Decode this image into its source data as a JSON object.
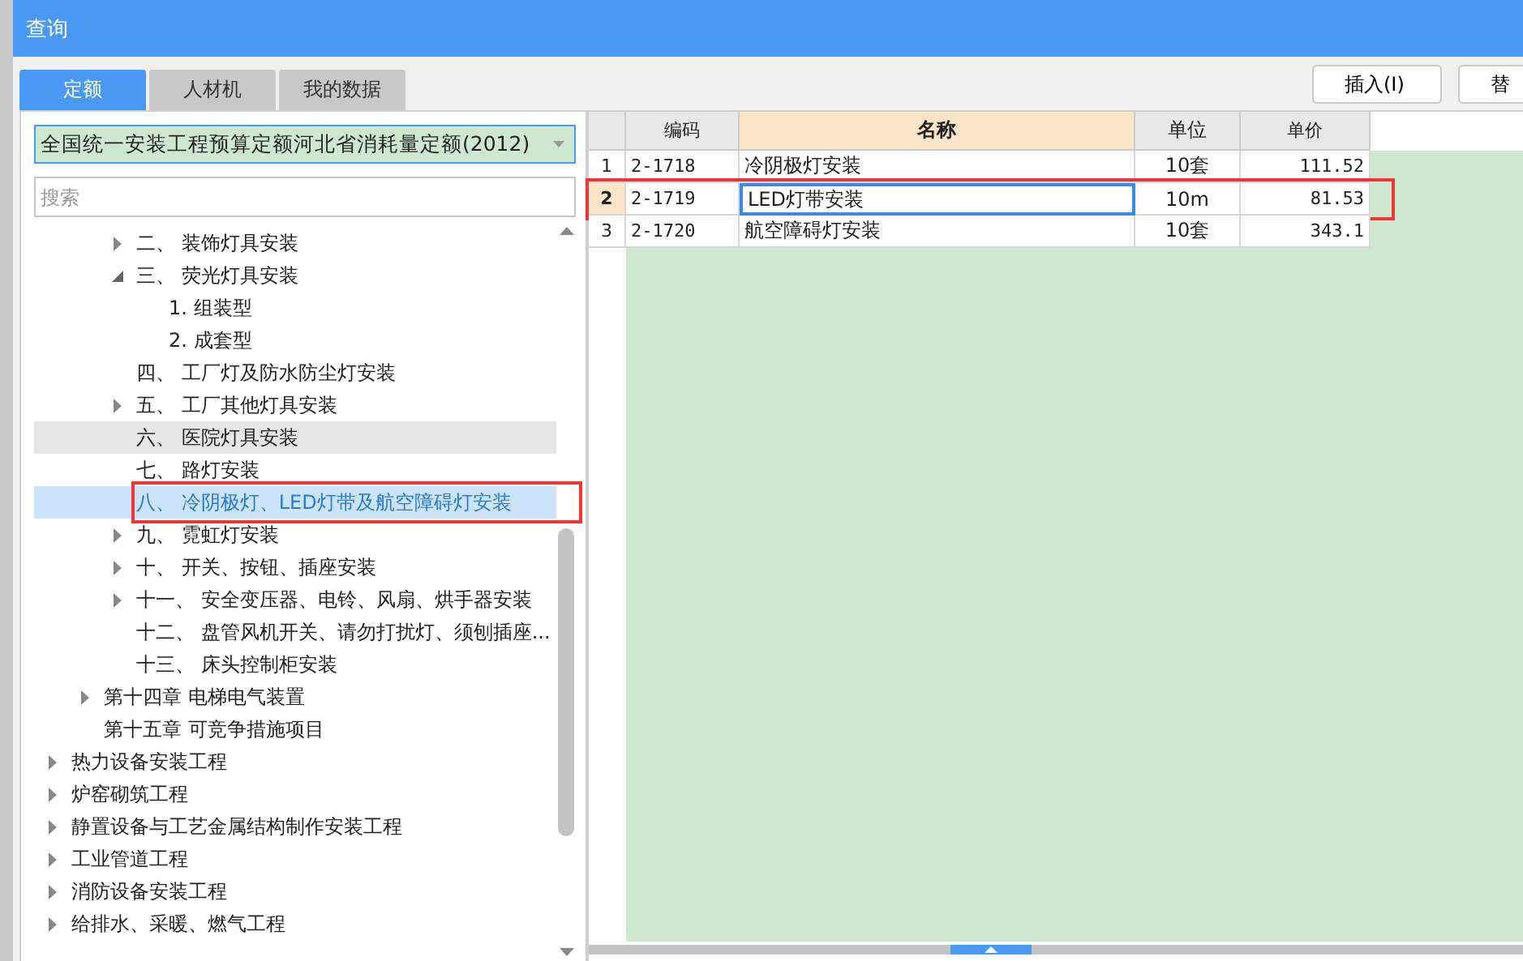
{
  "window": {
    "title": "查询"
  },
  "tabs": [
    {
      "label": "定额",
      "selected": true
    },
    {
      "label": "人材机",
      "selected": false
    },
    {
      "label": "我的数据",
      "selected": false
    }
  ],
  "buttons": [
    "插入(I)",
    "替"
  ],
  "library_select": {
    "value": "全国统一安装工程预算定额河北省消耗量定额(2012)"
  },
  "search": {
    "placeholder": "搜索"
  },
  "tree": [
    {
      "children": [
        {
          "children": [
            {
              "label": "二、 装饰灯具安装",
              "expanded": false,
              "selected": false,
              "hovered": false,
              "annotated": false
            },
            {
              "label": "三、 荧光灯具安装",
              "expanded": true,
              "selected": false,
              "hovered": false,
              "annotated": false,
              "children": [
                {
                  "label": "1. 组装型",
                  "selected": false,
                  "hovered": false,
                  "annotated": false
                },
                {
                  "label": "2. 成套型",
                  "selected": false,
                  "hovered": false,
                  "annotated": false
                }
              ]
            },
            {
              "label": "四、 工厂灯及防水防尘灯安装",
              "selected": false,
              "hovered": false,
              "annotated": false
            },
            {
              "label": "五、 工厂其他灯具安装",
              "expanded": false,
              "selected": false,
              "hovered": false,
              "annotated": false
            },
            {
              "label": "六、 医院灯具安装",
              "selected": false,
              "hovered": true,
              "annotated": false
            },
            {
              "label": "七、 路灯安装",
              "selected": false,
              "hovered": false,
              "annotated": false
            },
            {
              "label": "八、 冷阴极灯、LED灯带及航空障碍灯安装",
              "selected": true,
              "hovered": false,
              "annotated": true
            },
            {
              "label": "九、 霓虹灯安装",
              "expanded": false,
              "selected": false,
              "hovered": false,
              "annotated": false
            },
            {
              "label": "十、 开关、按钮、插座安装",
              "expanded": false,
              "selected": false,
              "hovered": false,
              "annotated": false
            },
            {
              "label": "十一、 安全变压器、电铃、风扇、烘手器安装",
              "expanded": false,
              "selected": false,
              "hovered": false,
              "annotated": false
            },
            {
              "label": "十二、 盘管风机开关、请勿打扰灯、须刨插座...",
              "selected": false,
              "hovered": false,
              "annotated": false
            },
            {
              "label": "十三、 床头控制柜安装",
              "selected": false,
              "hovered": false,
              "annotated": false
            }
          ]
        },
        {
          "label": "第十四章 电梯电气装置",
          "expanded": false,
          "selected": false,
          "hovered": false,
          "annotated": false
        },
        {
          "label": "第十五章 可竞争措施项目",
          "selected": false,
          "hovered": false,
          "annotated": false
        }
      ]
    },
    {
      "label": "热力设备安装工程",
      "expanded": false,
      "selected": false,
      "hovered": false,
      "annotated": false
    },
    {
      "label": "炉窑砌筑工程",
      "expanded": false,
      "selected": false,
      "hovered": false,
      "annotated": false
    },
    {
      "label": "静置设备与工艺金属结构制作安装工程",
      "expanded": false,
      "selected": false,
      "hovered": false,
      "annotated": false
    },
    {
      "label": "工业管道工程",
      "expanded": false,
      "selected": false,
      "hovered": false,
      "annotated": false
    },
    {
      "label": "消防设备安装工程",
      "expanded": false,
      "selected": false,
      "hovered": false,
      "annotated": false
    },
    {
      "label": "给排水、采暖、燃气工程",
      "expanded": false,
      "selected": false,
      "hovered": false,
      "annotated": false
    }
  ],
  "table": {
    "columns": [
      {
        "label": "编码",
        "selected": false
      },
      {
        "label": "名称",
        "selected": true
      },
      {
        "label": "单位",
        "selected": false
      },
      {
        "label": "单价",
        "selected": false
      }
    ],
    "rows": [
      {
        "number": "1",
        "code": "2-1718",
        "name": "冷阴极灯安装",
        "unit": "10套",
        "price": "111.52",
        "selected": false,
        "annotated": false
      },
      {
        "number": "2",
        "code": "2-1719",
        "name": "LED灯带安装",
        "unit": "10m",
        "price": "81.53",
        "selected": true,
        "annotated": true
      },
      {
        "number": "3",
        "code": "2-1720",
        "name": "航空障碍灯安装",
        "unit": "10套",
        "price": "343.1",
        "selected": false,
        "annotated": false
      }
    ]
  }
}
